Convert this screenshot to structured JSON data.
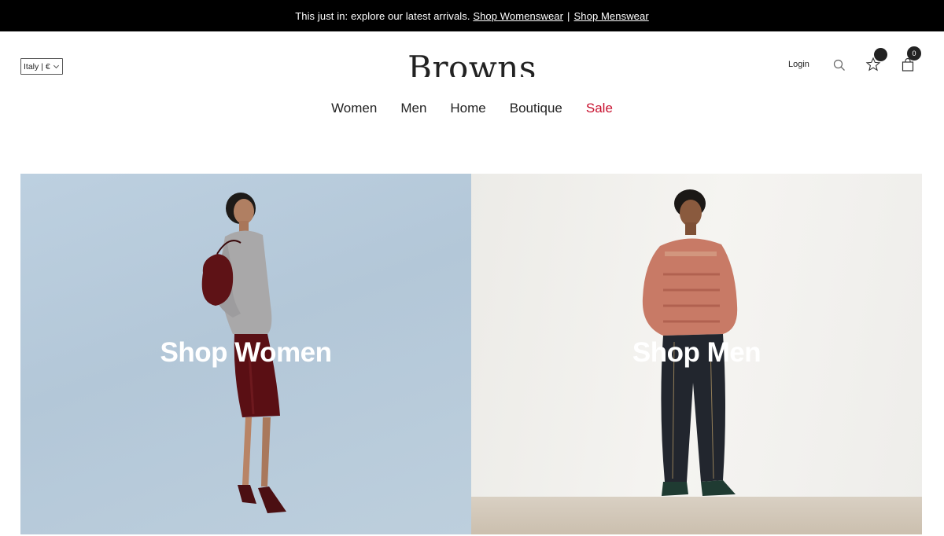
{
  "announcement": {
    "text": "This just in: explore our latest arrivals.",
    "link_women": "Shop Womenswear",
    "separator": "|",
    "link_men": "Shop Menswear"
  },
  "header": {
    "locale": "Italy | €",
    "logo": "Browns",
    "login": "Login",
    "bag_count": "0"
  },
  "nav": {
    "items": [
      "Women",
      "Men",
      "Home",
      "Boutique",
      "Sale"
    ]
  },
  "hero": {
    "women_label": "Shop Women",
    "men_label": "Shop Men"
  },
  "colors": {
    "announcement_bg": "#000000",
    "sale": "#c8102e",
    "women_panel_bg": "#b9cddd",
    "men_panel_bg": "#f0efeb"
  }
}
